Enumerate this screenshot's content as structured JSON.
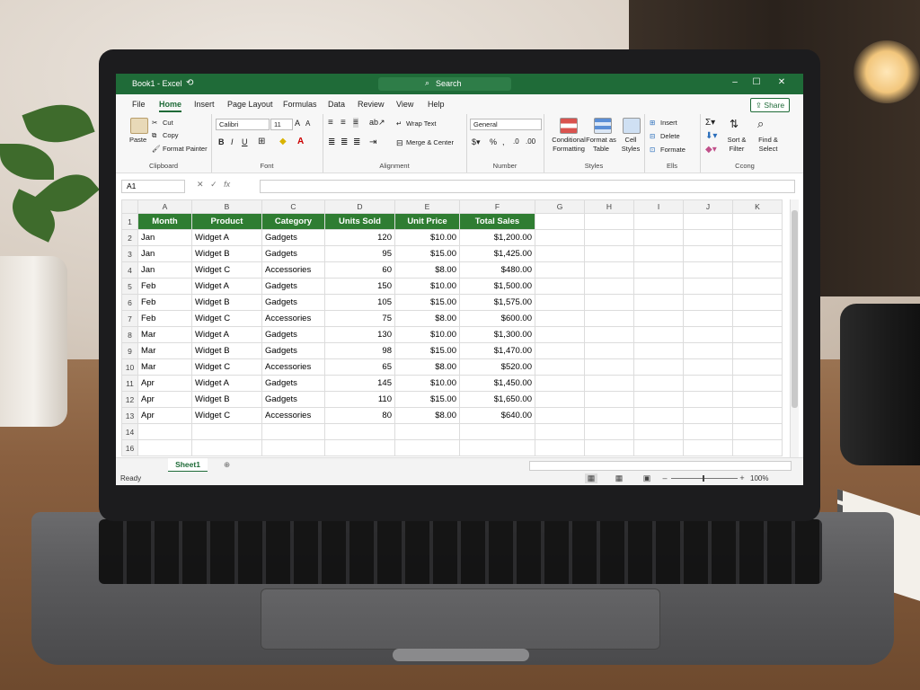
{
  "titlebar": {
    "title": "Book1 - Excel",
    "search": "Search"
  },
  "tabs": [
    "File",
    "Home",
    "Insert",
    "Page Layout",
    "Formulas",
    "Data",
    "Review",
    "View",
    "Help"
  ],
  "share": "Share",
  "ribbon": {
    "clipboard": {
      "paste": "Paste",
      "cut": "Cut",
      "copy": "Copy",
      "format_painter": "Format Painter",
      "label": "Clipboard"
    },
    "font": {
      "name": "Calibri",
      "size": "11",
      "label": "Font"
    },
    "alignment": {
      "wrap": "Wrap Text",
      "merge": "Merge & Center",
      "label": "Alignment"
    },
    "number": {
      "format": "General",
      "label": "Number"
    },
    "styles": {
      "conditional": "Conditional Formatting",
      "format_table": "Format as Table",
      "cell_styles": "Cell Styles",
      "label": "Styles"
    },
    "cells": {
      "insert": "Insert",
      "delete": "Delete",
      "format": "Formate",
      "label": "Ells"
    },
    "editing": {
      "sort": "Sort & Filter",
      "find": "Find & Select",
      "label": "Ccong"
    }
  },
  "formula_bar": {
    "name_box": "A1",
    "fx": "fx"
  },
  "columns": [
    "A",
    "B",
    "C",
    "D",
    "E",
    "F",
    "G",
    "H",
    "I",
    "J",
    "K"
  ],
  "headers": [
    "Month",
    "Product",
    "Category",
    "Units Sold",
    "Unit Price",
    "Total Sales"
  ],
  "rows": [
    [
      "Jan",
      "Widget A",
      "Gadgets",
      "120",
      "$10.00",
      "$1,200.00"
    ],
    [
      "Jan",
      "Widget B",
      "Gadgets",
      "95",
      "$15.00",
      "$1,425.00"
    ],
    [
      "Jan",
      "Widget C",
      "Accessories",
      "60",
      "$8.00",
      "$480.00"
    ],
    [
      "Feb",
      "Widget A",
      "Gadgets",
      "150",
      "$10.00",
      "$1,500.00"
    ],
    [
      "Feb",
      "Widget B",
      "Gadgets",
      "105",
      "$15.00",
      "$1,575.00"
    ],
    [
      "Feb",
      "Widget C",
      "Accessories",
      "75",
      "$8.00",
      "$600.00"
    ],
    [
      "Mar",
      "Widget A",
      "Gadgets",
      "130",
      "$10.00",
      "$1,300.00"
    ],
    [
      "Mar",
      "Widget B",
      "Gadgets",
      "98",
      "$15.00",
      "$1,470.00"
    ],
    [
      "Mar",
      "Widget C",
      "Accessories",
      "65",
      "$8.00",
      "$520.00"
    ],
    [
      "Apr",
      "Widget A",
      "Gadgets",
      "145",
      "$10.00",
      "$1,450.00"
    ],
    [
      "Apr",
      "Widget B",
      "Gadgets",
      "110",
      "$15.00",
      "$1,650.00"
    ],
    [
      "Apr",
      "Widget C",
      "Accessories",
      "80",
      "$8.00",
      "$640.00"
    ]
  ],
  "row_numbers": [
    "1",
    "2",
    "3",
    "4",
    "5",
    "6",
    "7",
    "8",
    "9",
    "10",
    "11",
    "12",
    "13",
    "14",
    "16"
  ],
  "sheet_tab": "Sheet1",
  "status": {
    "ready": "Ready",
    "zoom": "100%"
  },
  "colors": {
    "excel_green": "#1f6b38",
    "header_green": "#2f7d32"
  }
}
